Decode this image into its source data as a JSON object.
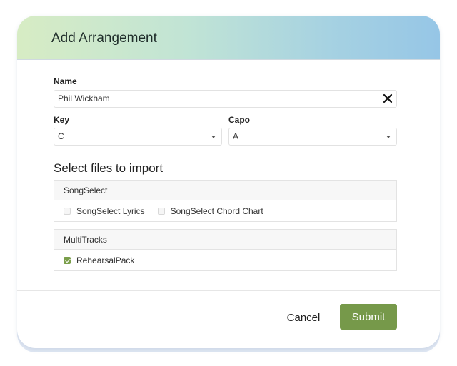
{
  "dialog": {
    "title": "Add Arrangement"
  },
  "form": {
    "name_label": "Name",
    "name_value": "Phil Wickham",
    "key_label": "Key",
    "key_value": "C",
    "capo_label": "Capo",
    "capo_value": "A"
  },
  "import": {
    "heading": "Select files to import",
    "groups": [
      {
        "title": "SongSelect",
        "options": [
          {
            "label": "SongSelect Lyrics",
            "checked": false
          },
          {
            "label": "SongSelect Chord Chart",
            "checked": false
          }
        ]
      },
      {
        "title": "MultiTracks",
        "options": [
          {
            "label": "RehearsalPack",
            "checked": true
          }
        ]
      }
    ]
  },
  "footer": {
    "cancel_label": "Cancel",
    "submit_label": "Submit"
  },
  "colors": {
    "accent": "#76994a",
    "header_gradient_start": "#d7ecc4",
    "header_gradient_end": "#96c6e6"
  }
}
